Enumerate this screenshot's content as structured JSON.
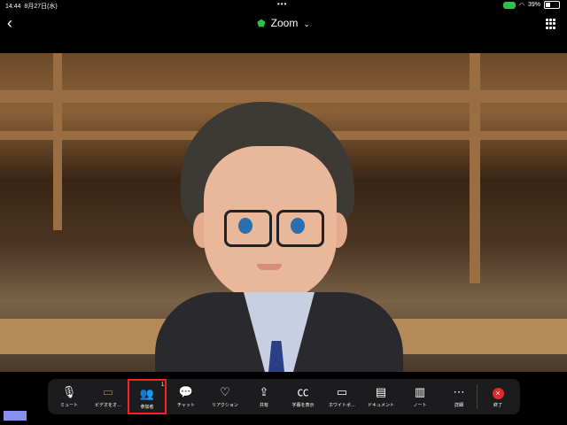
{
  "status": {
    "time": "14:44",
    "date": "8月27日(水)",
    "battery": "39%",
    "battery_level": 0.39
  },
  "topbar": {
    "title": "Zoom"
  },
  "toolbar": {
    "buttons": [
      {
        "label": "ミュート",
        "icon": "mic-icon"
      },
      {
        "label": "ビデオをオ…",
        "icon": "video-icon"
      },
      {
        "label": "参加者",
        "icon": "participants-icon",
        "badge": "1"
      },
      {
        "label": "チャット",
        "icon": "chat-icon"
      },
      {
        "label": "リアクション",
        "icon": "heart-icon"
      },
      {
        "label": "共有",
        "icon": "share-icon"
      },
      {
        "label": "字幕を表示",
        "icon": "cc-icon"
      },
      {
        "label": "ホワイトボ…",
        "icon": "whiteboard-icon"
      },
      {
        "label": "ドキュメント",
        "icon": "document-icon"
      },
      {
        "label": "ノート",
        "icon": "note-icon"
      },
      {
        "label": "詳細",
        "icon": "more-icon"
      },
      {
        "label": "終了",
        "icon": "end-icon"
      }
    ]
  },
  "colors": {
    "accent_green": "#2fbf4a",
    "highlight_red": "#ff2020",
    "end_red": "#e02b2b"
  }
}
